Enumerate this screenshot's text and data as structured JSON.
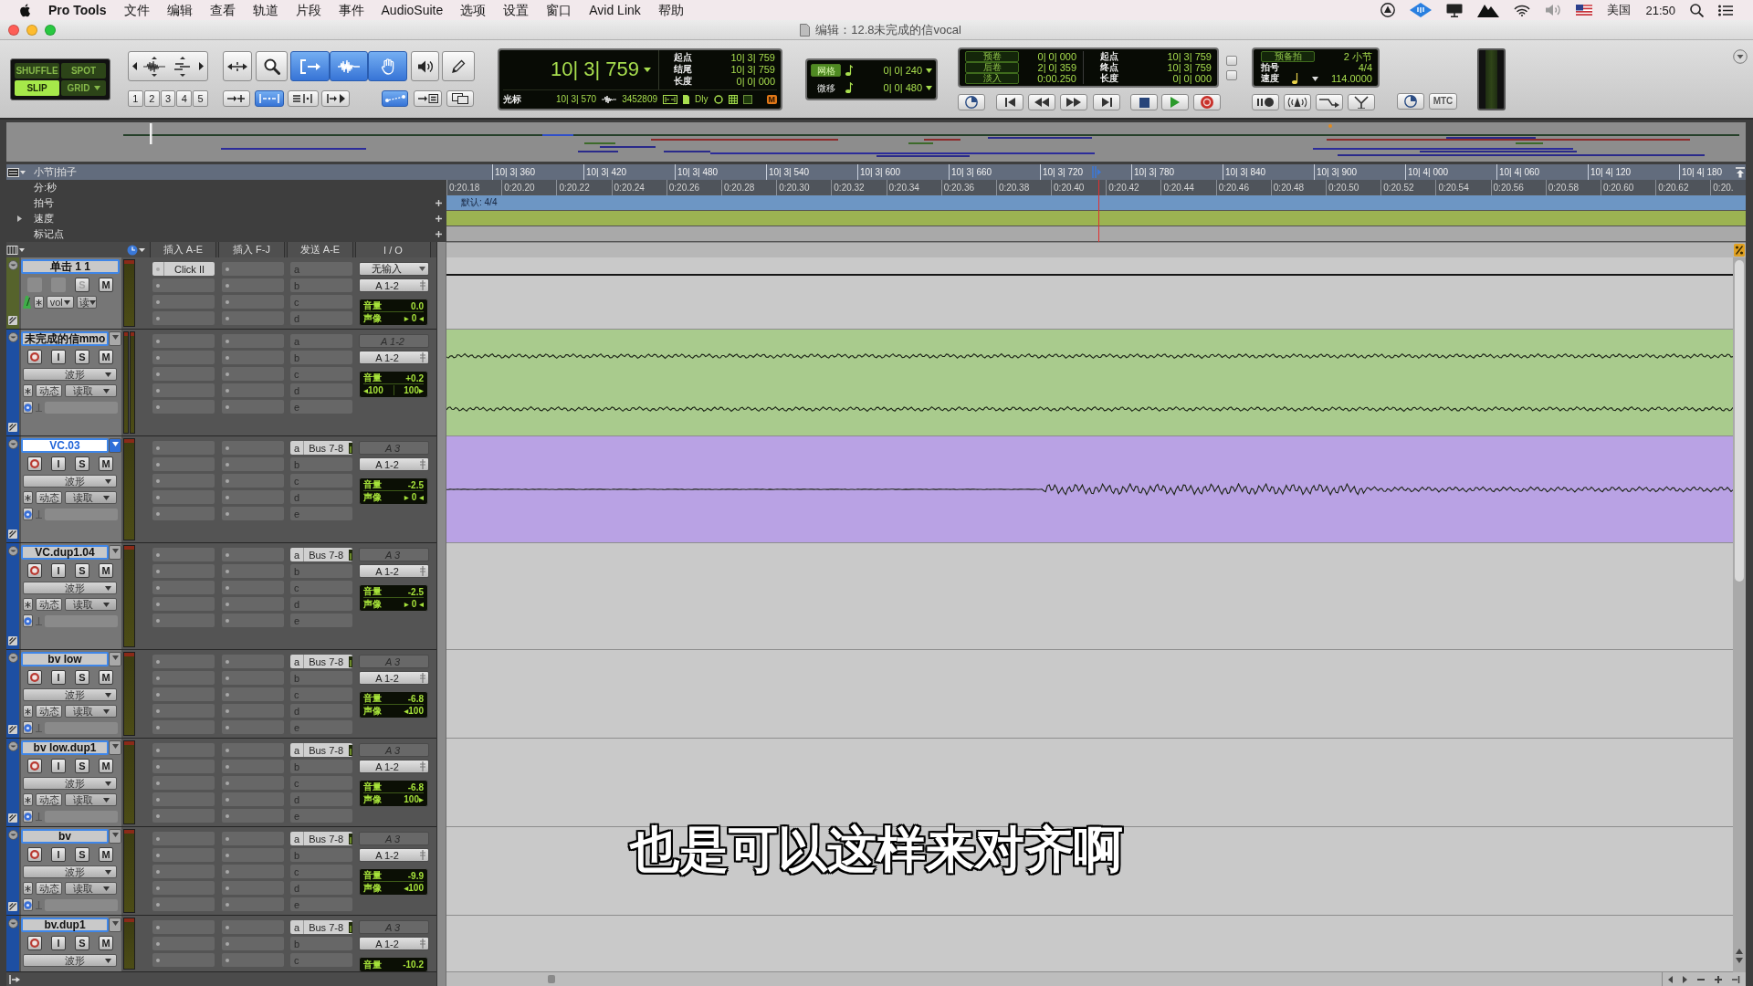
{
  "menu_bar": {
    "app": "Pro Tools",
    "items": [
      "文件",
      "编辑",
      "查看",
      "轨道",
      "片段",
      "事件",
      "AudioSuite",
      "选项",
      "设置",
      "窗口",
      "Avid Link",
      "帮助"
    ],
    "input_source": "美国",
    "clock": "21:50"
  },
  "window": {
    "title": "编辑：12.8未完成的信vocal"
  },
  "toolbar": {
    "edit_modes": [
      {
        "label": "SHUFFLE",
        "kind": "toggle",
        "selected": false
      },
      {
        "label": "SPOT",
        "kind": "toggle",
        "selected": false
      },
      {
        "label": "SLIP",
        "kind": "toggle",
        "selected": true
      },
      {
        "label": "GRID",
        "kind": "menu",
        "selected": false
      }
    ],
    "zoom_presets": [
      "1",
      "2",
      "3",
      "4",
      "5"
    ],
    "tools": [
      {
        "kind": "expand",
        "selected": false
      },
      {
        "kind": "zoom",
        "selected": false
      },
      {
        "kind": "trim",
        "selected": true
      },
      {
        "kind": "select",
        "selected": true
      },
      {
        "kind": "grab",
        "selected": true
      },
      {
        "kind": "scrub",
        "selected": false
      },
      {
        "kind": "pencil",
        "selected": false
      }
    ],
    "options": [
      {
        "kind": "tab",
        "selected": false
      },
      {
        "kind": "insertion",
        "selected": true
      },
      {
        "kind": "lines",
        "selected": false
      },
      {
        "kind": "jump",
        "selected": false
      },
      {
        "kind": "link",
        "selected": true
      },
      {
        "kind": "move",
        "selected": false
      },
      {
        "kind": "windows",
        "selected": false
      }
    ],
    "counter": {
      "main": "10| 3| 759",
      "rows": [
        {
          "label": "起点",
          "value": "10| 3| 759"
        },
        {
          "label": "结尾",
          "value": "10| 3| 759"
        },
        {
          "label": "长度",
          "value": "0| 0| 000"
        }
      ],
      "cursor_label": "光标",
      "cursor": "10| 3| 570",
      "sample": "3452809",
      "delay": "Dly",
      "badge": "M"
    },
    "grid_nudge": [
      {
        "label": "网格",
        "value": "0| 0| 240",
        "selected": true
      },
      {
        "label": "微移",
        "value": "0| 0| 480",
        "selected": false
      }
    ],
    "transport": {
      "rolls": [
        {
          "label": "预卷",
          "value": "0| 0| 000"
        },
        {
          "label": "后卷",
          "value": "2| 0| 359"
        },
        {
          "label": "淡入",
          "value": "0:00.250"
        }
      ],
      "selection": [
        {
          "label": "起点",
          "value": "10| 3| 759"
        },
        {
          "label": "终点",
          "value": "10| 3| 759"
        },
        {
          "label": "长度",
          "value": "0| 0| 000"
        }
      ]
    },
    "midi": {
      "count_in_label": "预备拍",
      "count_in": "2 小节",
      "meter_label": "拍号",
      "meter": "4/4",
      "tempo_label": "速度",
      "tempo": "114.0000"
    },
    "sync_button": "MTC"
  },
  "rulers": {
    "bars_beats": {
      "label": "小节|拍子",
      "ticks": [
        "10| 3| 360",
        "10| 3| 420",
        "10| 3| 480",
        "10| 3| 540",
        "10| 3| 600",
        "10| 3| 660",
        "10| 3| 720",
        "10| 3| 780",
        "10| 3| 840",
        "10| 3| 900",
        "10| 4| 000",
        "10| 4| 060",
        "10| 4| 120",
        "10| 4| 180"
      ]
    },
    "min_secs": {
      "label": "分:秒",
      "ticks": [
        "0:20.18",
        "0:20.20",
        "0:20.22",
        "0:20.24",
        "0:20.26",
        "0:20.28",
        "0:20.30",
        "0:20.32",
        "0:20.34",
        "0:20.36",
        "0:20.38",
        "0:20.40",
        "0:20.42",
        "0:20.44",
        "0:20.46",
        "0:20.48",
        "0:20.50",
        "0:20.52",
        "0:20.54",
        "0:20.56",
        "0:20.58",
        "0:20.60",
        "0:20.62",
        "0:20."
      ]
    },
    "meter": {
      "label": "拍号",
      "marker": "默认: 4/4"
    },
    "tempo": {
      "label": "速度",
      "expanded": false
    },
    "markers": {
      "label": "标记点"
    }
  },
  "columns": [
    "插入 A-E",
    "插入 F-J",
    "发送 A-E",
    "I / O"
  ],
  "tracks": [
    {
      "name": "单击 1 1",
      "kind": "aux",
      "tall": false,
      "color": "#56632c",
      "selected": false,
      "buttons": [
        {
          "label": "S",
          "disabled": true
        },
        {
          "label": "M",
          "disabled": false
        }
      ],
      "view": "vol",
      "automation": "读",
      "inserts": [
        "Click II"
      ],
      "sends": [
        {
          "slot": "a"
        },
        {
          "slot": "b"
        },
        {
          "slot": "c"
        },
        {
          "slot": "d"
        }
      ],
      "input": "无输入",
      "output": "A 1-2",
      "mix": {
        "volume_label": "音量",
        "volume": "0.0",
        "pan_label": "声像",
        "pans": [
          "▸ 0 ◂"
        ]
      }
    },
    {
      "name": "未完成的信mmo",
      "kind": "audio",
      "tall": true,
      "color": "#1d4fa3",
      "selected": false,
      "buttons": [
        {
          "label": "I",
          "disabled": false
        },
        {
          "label": "S",
          "disabled": false
        },
        {
          "label": "M",
          "disabled": false
        }
      ],
      "view": "波形",
      "mode": "动态",
      "automation": "读取",
      "sends": [
        {
          "slot": "a"
        },
        {
          "slot": "b"
        },
        {
          "slot": "c"
        },
        {
          "slot": "d"
        },
        {
          "slot": "e"
        }
      ],
      "input": "A 1-2",
      "output": "A 1-2",
      "mix": {
        "volume_label": "音量",
        "volume": "+0.2",
        "pans": [
          "◂100",
          "100▸"
        ]
      },
      "region": {
        "kind": "stereo",
        "color": "#a9cb8d"
      }
    },
    {
      "name": "VC.03",
      "kind": "audio",
      "tall": true,
      "color": "#1d4fa3",
      "selected": true,
      "buttons": [
        {
          "label": "I",
          "disabled": false
        },
        {
          "label": "S",
          "disabled": false
        },
        {
          "label": "M",
          "disabled": false
        }
      ],
      "view": "波形",
      "mode": "动态",
      "automation": "读取",
      "sends": [
        {
          "slot": "a",
          "target": "Bus 7-8"
        },
        {
          "slot": "b"
        },
        {
          "slot": "c"
        },
        {
          "slot": "d"
        },
        {
          "slot": "e"
        }
      ],
      "input": "A 3",
      "output": "A 1-2",
      "mix": {
        "volume_label": "音量",
        "volume": "-2.5",
        "pan_label": "声像",
        "pans": [
          "▸ 0 ◂"
        ]
      },
      "region": {
        "kind": "mono",
        "color": "#b9a2e4"
      }
    },
    {
      "name": "VC.dup1.04",
      "kind": "audio",
      "tall": true,
      "color": "#1d4fa3",
      "selected": false,
      "buttons": [
        {
          "label": "I",
          "disabled": false
        },
        {
          "label": "S",
          "disabled": false
        },
        {
          "label": "M",
          "disabled": false
        }
      ],
      "view": "波形",
      "mode": "动态",
      "automation": "读取",
      "sends": [
        {
          "slot": "a",
          "target": "Bus 7-8"
        },
        {
          "slot": "b"
        },
        {
          "slot": "c"
        },
        {
          "slot": "d"
        },
        {
          "slot": "e"
        }
      ],
      "input": "A 3",
      "output": "A 1-2",
      "mix": {
        "volume_label": "音量",
        "volume": "-2.5",
        "pan_label": "声像",
        "pans": [
          "▸ 0 ◂"
        ]
      }
    },
    {
      "name": "bv low",
      "kind": "audio",
      "tall": false,
      "color": "#1d4fa3",
      "selected": false,
      "buttons": [
        {
          "label": "I",
          "disabled": false
        },
        {
          "label": "S",
          "disabled": false
        },
        {
          "label": "M",
          "disabled": false
        }
      ],
      "view": "波形",
      "mode": "动态",
      "automation": "读取",
      "sends": [
        {
          "slot": "a",
          "target": "Bus 7-8"
        },
        {
          "slot": "b"
        },
        {
          "slot": "c"
        },
        {
          "slot": "d"
        },
        {
          "slot": "e"
        }
      ],
      "input": "A 3",
      "output": "A 1-2",
      "mix": {
        "volume_label": "音量",
        "volume": "-6.8",
        "pan_label": "声像",
        "pans": [
          "◂100"
        ]
      }
    },
    {
      "name": "bv low.dup1",
      "kind": "audio",
      "tall": false,
      "color": "#1d4fa3",
      "selected": false,
      "buttons": [
        {
          "label": "I",
          "disabled": false
        },
        {
          "label": "S",
          "disabled": false
        },
        {
          "label": "M",
          "disabled": false
        }
      ],
      "view": "波形",
      "mode": "动态",
      "automation": "读取",
      "sends": [
        {
          "slot": "a",
          "target": "Bus 7-8"
        },
        {
          "slot": "b"
        },
        {
          "slot": "c"
        },
        {
          "slot": "d"
        },
        {
          "slot": "e"
        }
      ],
      "input": "A 3",
      "output": "A 1-2",
      "mix": {
        "volume_label": "音量",
        "volume": "-6.8",
        "pan_label": "声像",
        "pans": [
          "100▸"
        ]
      }
    },
    {
      "name": "bv",
      "kind": "audio",
      "tall": false,
      "color": "#1d4fa3",
      "selected": false,
      "buttons": [
        {
          "label": "I",
          "disabled": false
        },
        {
          "label": "S",
          "disabled": false
        },
        {
          "label": "M",
          "disabled": false
        }
      ],
      "view": "波形",
      "mode": "动态",
      "automation": "读取",
      "sends": [
        {
          "slot": "a",
          "target": "Bus 7-8"
        },
        {
          "slot": "b"
        },
        {
          "slot": "c"
        },
        {
          "slot": "d"
        },
        {
          "slot": "e"
        }
      ],
      "input": "A 3",
      "output": "A 1-2",
      "mix": {
        "volume_label": "音量",
        "volume": "-9.9",
        "pan_label": "声像",
        "pans": [
          "◂100"
        ]
      }
    },
    {
      "name": "bv.dup1",
      "kind": "audio",
      "color": "#1d4fa3",
      "selected": false,
      "buttons": [
        {
          "label": "I",
          "disabled": false
        },
        {
          "label": "S",
          "disabled": false
        },
        {
          "label": "M",
          "disabled": false
        }
      ],
      "view": "波形",
      "sends": [
        {
          "slot": "a",
          "target": "Bus 7-8"
        },
        {
          "slot": "b"
        },
        {
          "slot": "c"
        }
      ],
      "input": "A 3",
      "output": "A 1-2",
      "mix": {
        "volume_label": "音量",
        "volume": "-10.2"
      }
    }
  ],
  "subtitle": "也是可以这样来对齐啊"
}
